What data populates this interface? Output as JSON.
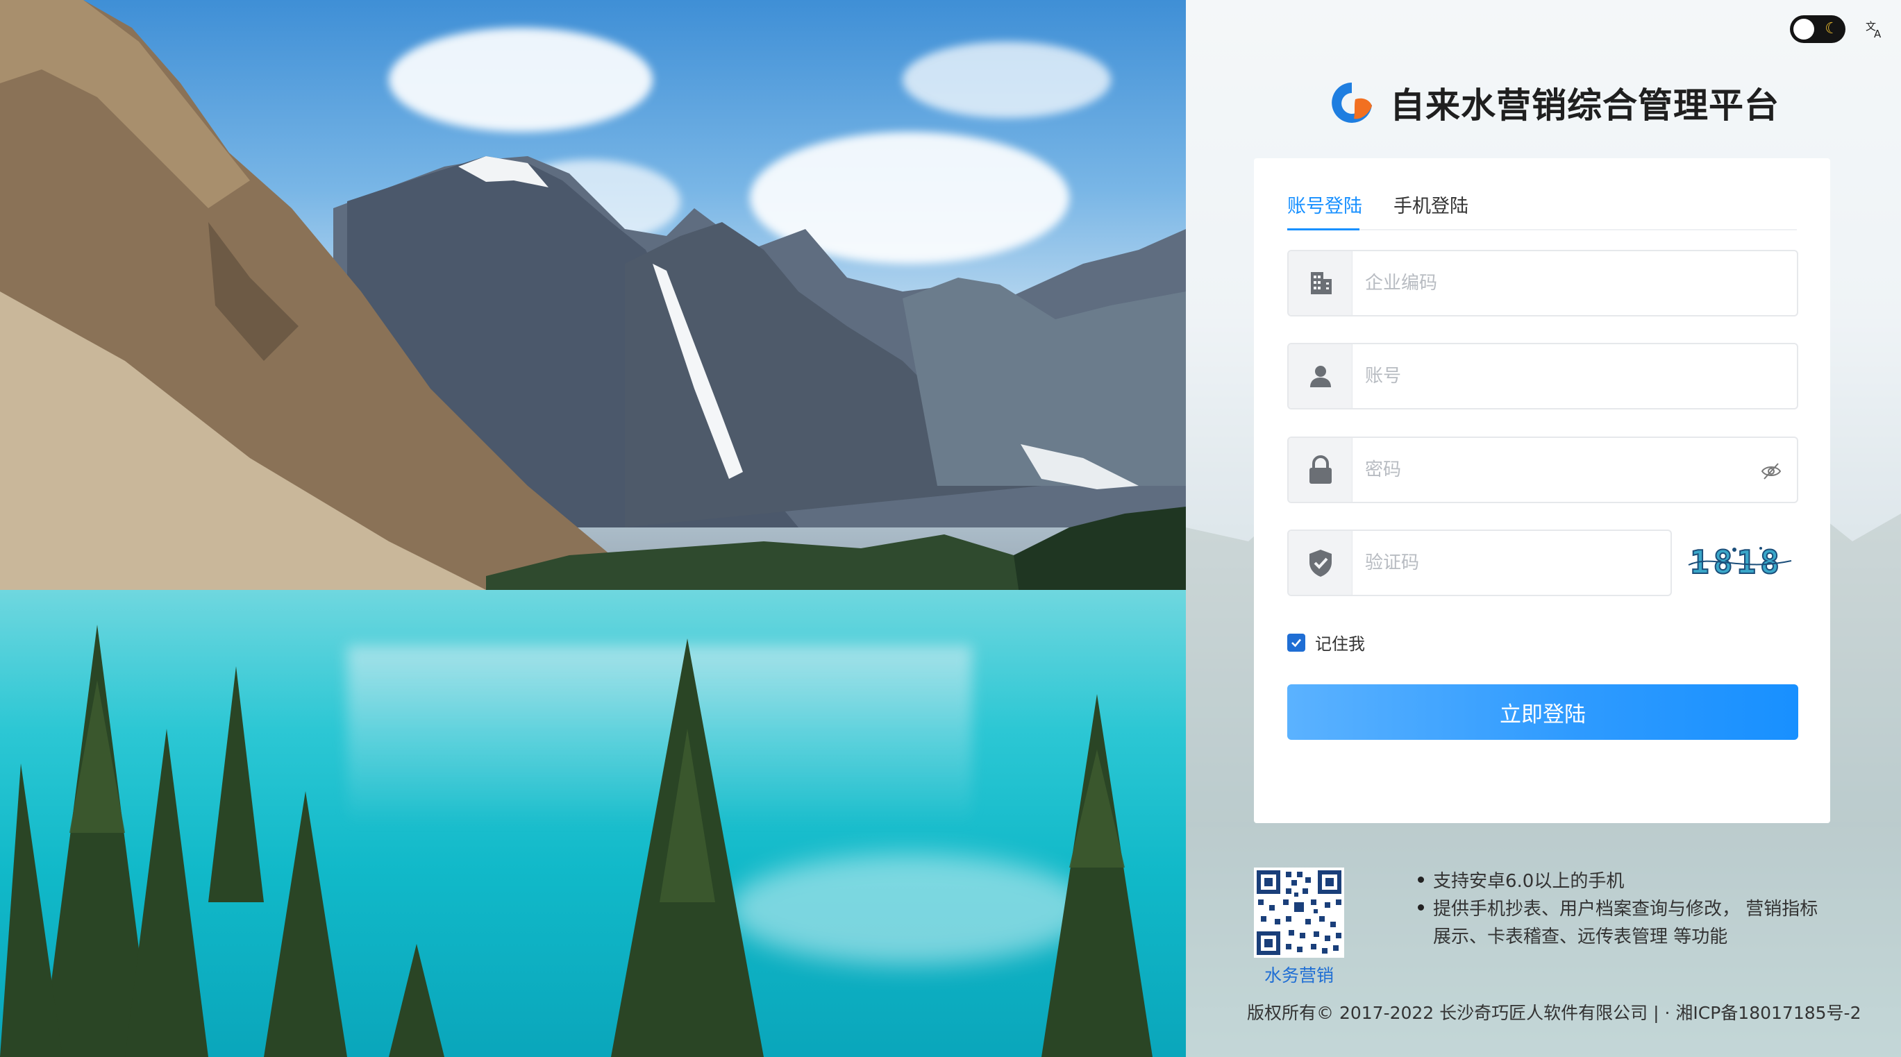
{
  "brand": {
    "title": "自来水营销综合管理平台",
    "logo_icon": "company-logo-icon",
    "logo_colors": [
      "#1f7ee0",
      "#f27021"
    ]
  },
  "header": {
    "theme_toggle_icon": "moon-icon",
    "language_icon": "translate-icon"
  },
  "login": {
    "tabs": [
      {
        "label": "账号登陆",
        "active": true
      },
      {
        "label": "手机登陆",
        "active": false
      }
    ],
    "fields": {
      "company": {
        "placeholder": "企业编码",
        "value": "",
        "icon": "building-icon"
      },
      "account": {
        "placeholder": "账号",
        "value": "",
        "icon": "user-icon"
      },
      "password": {
        "placeholder": "密码",
        "value": "",
        "icon": "lock-icon",
        "toggle_icon": "eye-off-icon"
      },
      "captcha": {
        "placeholder": "验证码",
        "value": "",
        "icon": "shield-check-icon",
        "code": "1818"
      }
    },
    "remember": {
      "label": "记住我",
      "checked": true
    },
    "submit_label": "立即登陆",
    "accent": "#1890ff"
  },
  "app_promo": {
    "qr_label": "水务营销",
    "features": [
      "支持安卓6.0以上的手机",
      "提供手机抄表、用户档案查询与修改， 营销指标展示、卡表稽查、远传表管理 等功能"
    ]
  },
  "footer": {
    "copyright": "版权所有© 2017-2022 长沙奇巧匠人软件有限公司 | ·",
    "icp": "湘ICP备18017185号-2"
  }
}
